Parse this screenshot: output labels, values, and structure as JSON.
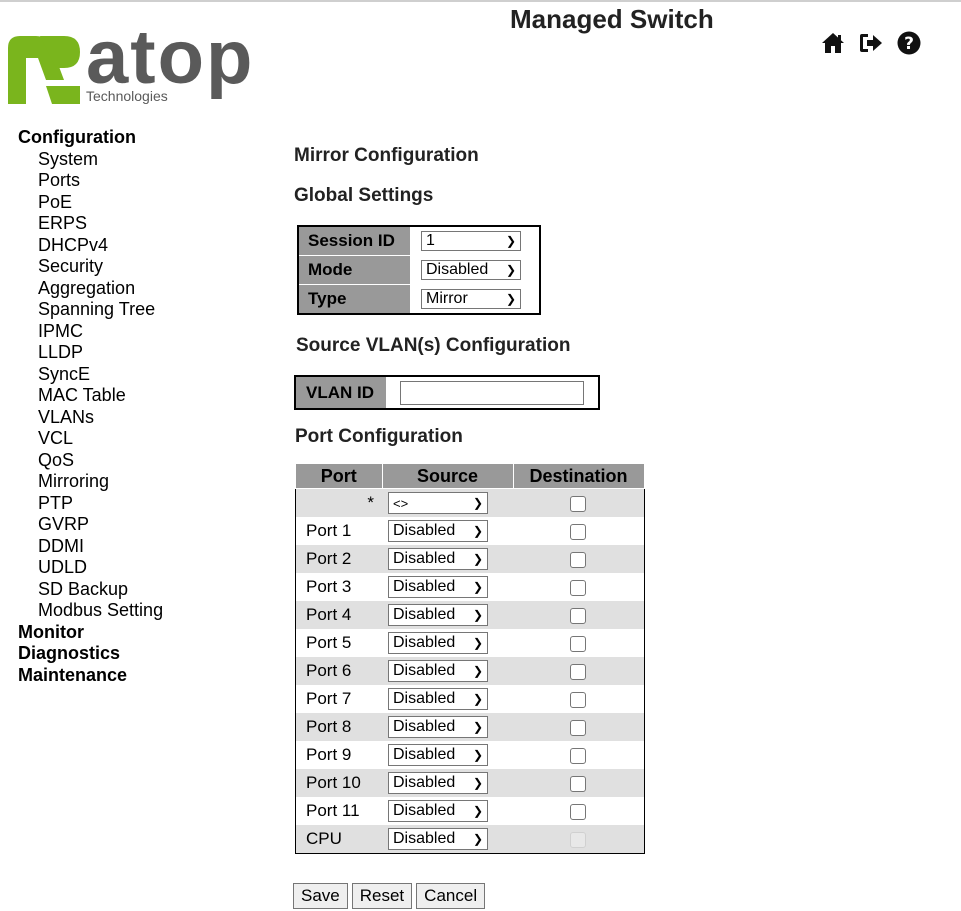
{
  "header": {
    "title": "Managed Switch"
  },
  "logo": {
    "name": "atop",
    "subtitle": "Technologies"
  },
  "nav": {
    "configuration": "Configuration",
    "items": [
      "System",
      "Ports",
      "PoE",
      "ERPS",
      "DHCPv4",
      "Security",
      "Aggregation",
      "Spanning Tree",
      "IPMC",
      "LLDP",
      "SyncE",
      "MAC Table",
      "VLANs",
      "VCL",
      "QoS",
      "Mirroring",
      "PTP",
      "GVRP",
      "DDMI",
      "UDLD",
      "SD Backup",
      "Modbus Setting"
    ],
    "monitor": "Monitor",
    "diagnostics": "Diagnostics",
    "maintenance": "Maintenance"
  },
  "page": {
    "title": "Mirror Configuration",
    "global_settings": "Global Settings",
    "source_vlan": "Source VLAN(s) Configuration",
    "port_config": "Port Configuration"
  },
  "global": {
    "session_label": "Session ID",
    "session_value": "1",
    "mode_label": "Mode",
    "mode_value": "Disabled",
    "type_label": "Type",
    "type_value": "Mirror"
  },
  "vlan": {
    "label": "VLAN ID",
    "value": ""
  },
  "ports": {
    "headers": {
      "port": "Port",
      "source": "Source",
      "destination": "Destination"
    },
    "all_label": "*",
    "all_source": "<>",
    "rows": [
      {
        "port": "Port 1",
        "source": "Disabled"
      },
      {
        "port": "Port 2",
        "source": "Disabled"
      },
      {
        "port": "Port 3",
        "source": "Disabled"
      },
      {
        "port": "Port 4",
        "source": "Disabled"
      },
      {
        "port": "Port 5",
        "source": "Disabled"
      },
      {
        "port": "Port 6",
        "source": "Disabled"
      },
      {
        "port": "Port 7",
        "source": "Disabled"
      },
      {
        "port": "Port 8",
        "source": "Disabled"
      },
      {
        "port": "Port 9",
        "source": "Disabled"
      },
      {
        "port": "Port 10",
        "source": "Disabled"
      },
      {
        "port": "Port 11",
        "source": "Disabled"
      },
      {
        "port": "CPU",
        "source": "Disabled"
      }
    ]
  },
  "buttons": {
    "save": "Save",
    "reset": "Reset",
    "cancel": "Cancel"
  },
  "icons": {
    "home": "home-icon",
    "logout": "sign-out-icon",
    "help": "help-icon"
  },
  "colors": {
    "table_header": "#999999",
    "row_alt": "#e0e0e0",
    "logo_green": "#7ab51d",
    "logo_gray": "#5a5a5a"
  }
}
